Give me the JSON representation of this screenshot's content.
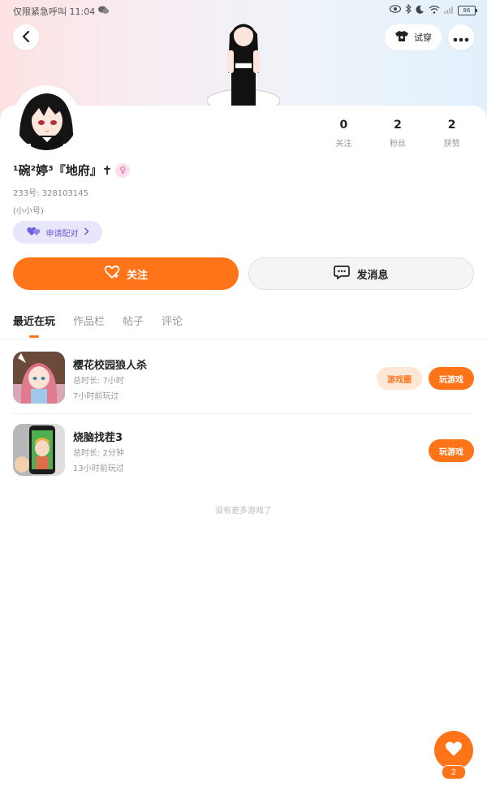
{
  "status_bar": {
    "left_text": "仅限紧急呼叫 11:04",
    "battery": "86"
  },
  "header": {
    "tryon_label": "试穿"
  },
  "profile": {
    "stats": [
      {
        "value": "0",
        "label": "关注"
      },
      {
        "value": "2",
        "label": "粉丝"
      },
      {
        "value": "2",
        "label": "获赞"
      }
    ],
    "username": "¹碗²婷³『地府』✝",
    "uid": "233号: 328103145",
    "note": "(小小号)",
    "pair_label": "申请配对",
    "follow_label": "关注",
    "message_label": "发消息"
  },
  "tabs": [
    {
      "label": "最近在玩",
      "active": true
    },
    {
      "label": "作品栏",
      "active": false
    },
    {
      "label": "帖子",
      "active": false
    },
    {
      "label": "评论",
      "active": false
    }
  ],
  "games": [
    {
      "title": "樱花校园狼人杀",
      "duration": "总时长: 7小时",
      "last_played": "7小时前玩过",
      "circle_label": "游戏圈",
      "play_label": "玩游戏"
    },
    {
      "title": "烧脑找茬3",
      "duration": "总时长: 2分钟",
      "last_played": "13小时前玩过",
      "play_label": "玩游戏"
    }
  ],
  "no_more": "没有更多游戏了",
  "fab": {
    "count": "2"
  },
  "colors": {
    "accent": "#ff7419",
    "pair_bg": "#e8e6fb",
    "pair_text": "#6a5fd8"
  }
}
